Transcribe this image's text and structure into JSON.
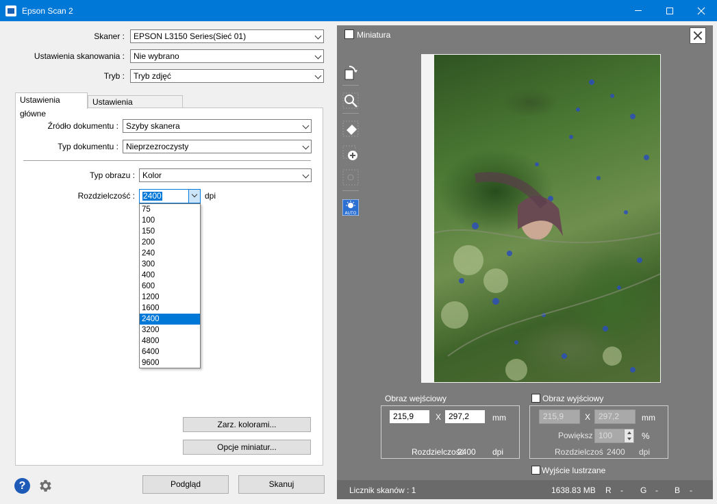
{
  "window": {
    "title": "Epson Scan 2"
  },
  "form": {
    "scanner_label": "Skaner :",
    "scanner_value": "EPSON L3150 Series(Sieć 01)",
    "settings_label": "Ustawienia skanowania :",
    "settings_value": "Nie wybrano",
    "mode_label": "Tryb :",
    "mode_value": "Tryb zdjęć"
  },
  "tabs": [
    {
      "label": "Ustawienia główne",
      "active": true
    },
    {
      "label": "Ustawienia zaawansowane",
      "active": false
    }
  ],
  "main": {
    "source_label": "Źródło dokumentu :",
    "source_value": "Szyby skanera",
    "doctype_label": "Typ dokumentu :",
    "doctype_value": "Nieprzezroczysty",
    "imagetype_label": "Typ obrazu :",
    "imagetype_value": "Kolor",
    "resolution_label": "Rozdzielczość :",
    "resolution_value": "2400",
    "resolution_unit": "dpi",
    "resolution_options": [
      "75",
      "100",
      "150",
      "200",
      "240",
      "300",
      "400",
      "600",
      "1200",
      "1600",
      "2400",
      "3200",
      "4800",
      "6400",
      "9600"
    ],
    "resolution_selected": "2400",
    "color_mgmt_button": "Zarz. kolorami...",
    "thumb_options_button": "Opcje miniatur..."
  },
  "footer": {
    "preview_button": "Podgląd",
    "scan_button": "Skanuj"
  },
  "preview": {
    "thumbnail_label": "Miniatura",
    "input": {
      "title": "Obraz wejściowy",
      "width": "215,9",
      "x": "X",
      "height": "297,2",
      "unit": "mm",
      "resolution_label": "Rozdzielczość",
      "resolution_value": "2400",
      "resolution_unit": "dpi"
    },
    "output": {
      "title": "Obraz wyjściowy",
      "width": "215,9",
      "x": "X",
      "height": "297,2",
      "unit": "mm",
      "scale_label": "Powiększ",
      "scale_value": "100",
      "scale_unit": "%",
      "resolution_label": "Rozdzielczoś",
      "resolution_value": "2400",
      "resolution_unit": "dpi"
    },
    "mirror_label": "Wyjście lustrzane"
  },
  "status": {
    "counter": "Licznik skanów : 1",
    "size": "1638.83 MB",
    "r": "R",
    "r_val": "-",
    "g": "G",
    "g_val": "-",
    "b": "B",
    "b_val": "-"
  }
}
